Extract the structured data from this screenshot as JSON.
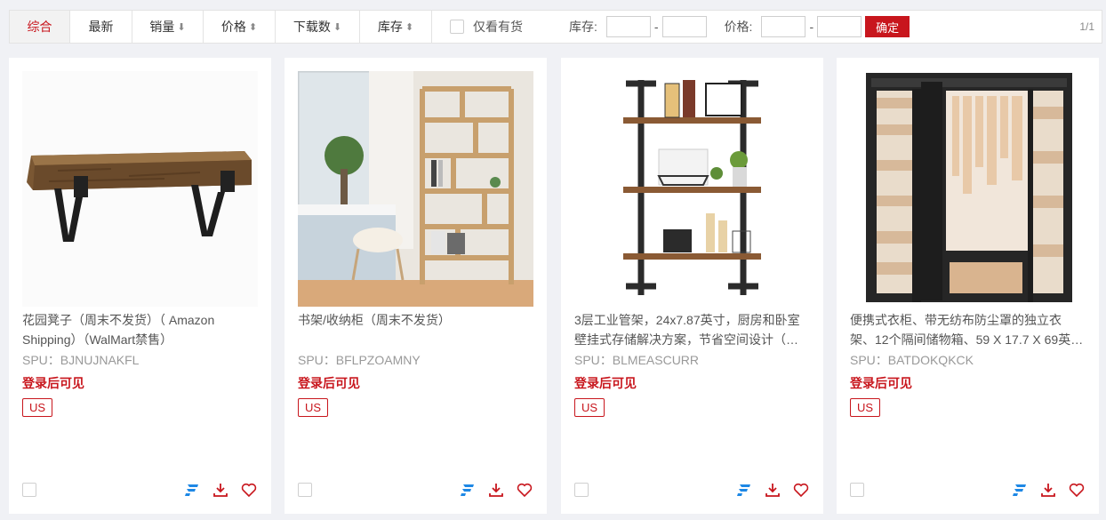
{
  "toolbar": {
    "sort_tabs": [
      {
        "label": "综合",
        "arrow": ""
      },
      {
        "label": "最新",
        "arrow": ""
      },
      {
        "label": "销量",
        "arrow": "⬇"
      },
      {
        "label": "价格",
        "arrow": "⬍"
      },
      {
        "label": "下载数",
        "arrow": "⬇"
      },
      {
        "label": "库存",
        "arrow": "⬍"
      }
    ],
    "in_stock_only_label": "仅看有货",
    "stock_range_label": "库存:",
    "price_range_label": "价格:",
    "range_separator": "-",
    "stock_min": "",
    "stock_max": "",
    "price_min": "",
    "price_max": "",
    "confirm_label": "确定",
    "page_indicator": "1/1"
  },
  "products": [
    {
      "title": "花园凳子（周末不发货）（ Amazon Shipping）（WalMart禁售）",
      "spu": "SPU：BJNUJNAKFL",
      "price_note": "登录后可见",
      "region": "US",
      "image": "bench"
    },
    {
      "title": "书架/收纳柜（周末不发货）",
      "spu": "SPU：BFLPZOAMNY",
      "price_note": "登录后可见",
      "region": "US",
      "image": "bookshelf"
    },
    {
      "title": "3层工业管架，24x7.87英寸，厨房和卧室壁挂式存储解决方案，节省空间设计（…",
      "spu": "SPU：BLMEASCURR",
      "price_note": "登录后可见",
      "region": "US",
      "image": "pipe-shelf"
    },
    {
      "title": "便携式衣柜、带无纺布防尘罩的独立衣架、12个隔间储物箱、59 X 17.7 X 69英…",
      "spu": "SPU：BATDOKQKCK",
      "price_note": "登录后可见",
      "region": "US",
      "image": "wardrobe"
    }
  ],
  "icons": [
    "flag-icon",
    "download-icon",
    "heart-icon"
  ],
  "colors": {
    "accent": "#c8161d",
    "brand_blue": "#1e88e5"
  }
}
